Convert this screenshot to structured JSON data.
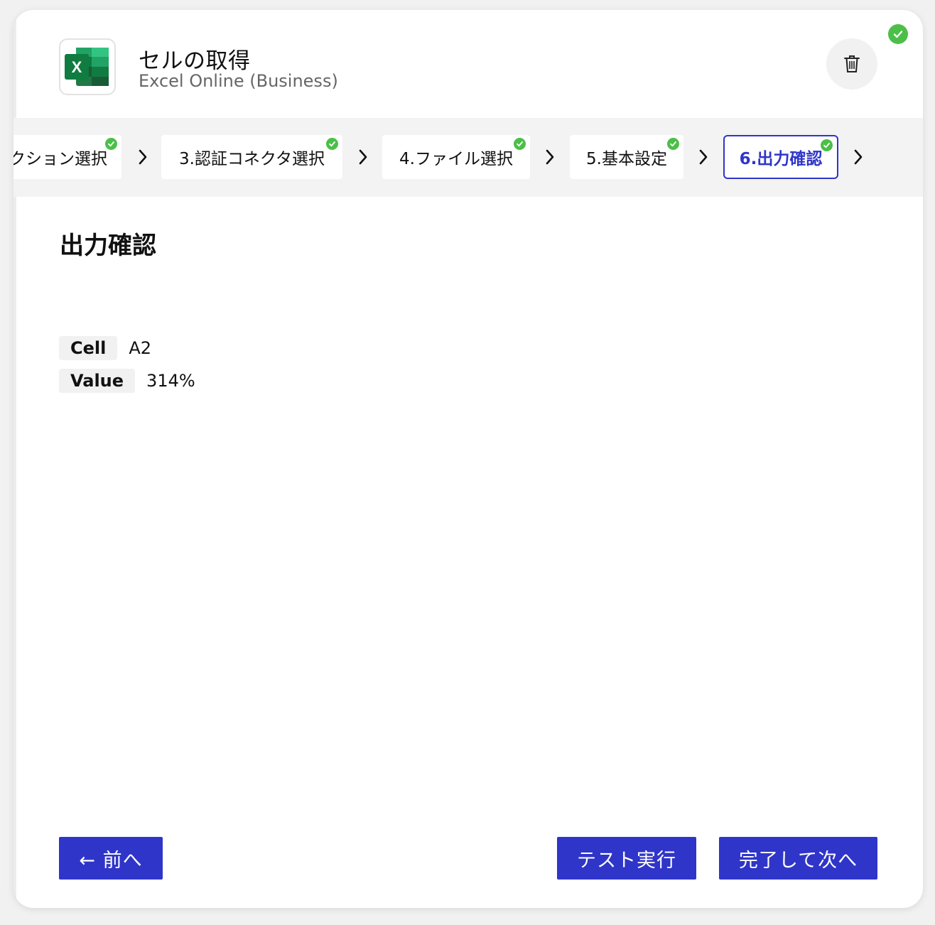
{
  "header": {
    "title": "セルの取得",
    "subtitle": "Excel Online (Business)",
    "app_icon": "excel-icon",
    "delete_icon": "trash-icon",
    "status_icon": "check-circle-icon"
  },
  "stepper": {
    "steps": [
      {
        "label": "ァクション選択",
        "status": "done"
      },
      {
        "label": "3.認証コネクタ選択",
        "status": "done"
      },
      {
        "label": "4.ファイル選択",
        "status": "done"
      },
      {
        "label": "5.基本設定",
        "status": "done"
      },
      {
        "label": "6.出力確認",
        "status": "active"
      }
    ]
  },
  "content": {
    "section_title": "出力確認",
    "outputs": [
      {
        "key": "Cell",
        "value": "A2"
      },
      {
        "key": "Value",
        "value": "314%"
      }
    ]
  },
  "footer": {
    "back_label": "← 前へ",
    "test_label": "テスト実行",
    "next_label": "完了して次へ"
  },
  "colors": {
    "accent": "#2f35c9",
    "success": "#4bbf47"
  }
}
